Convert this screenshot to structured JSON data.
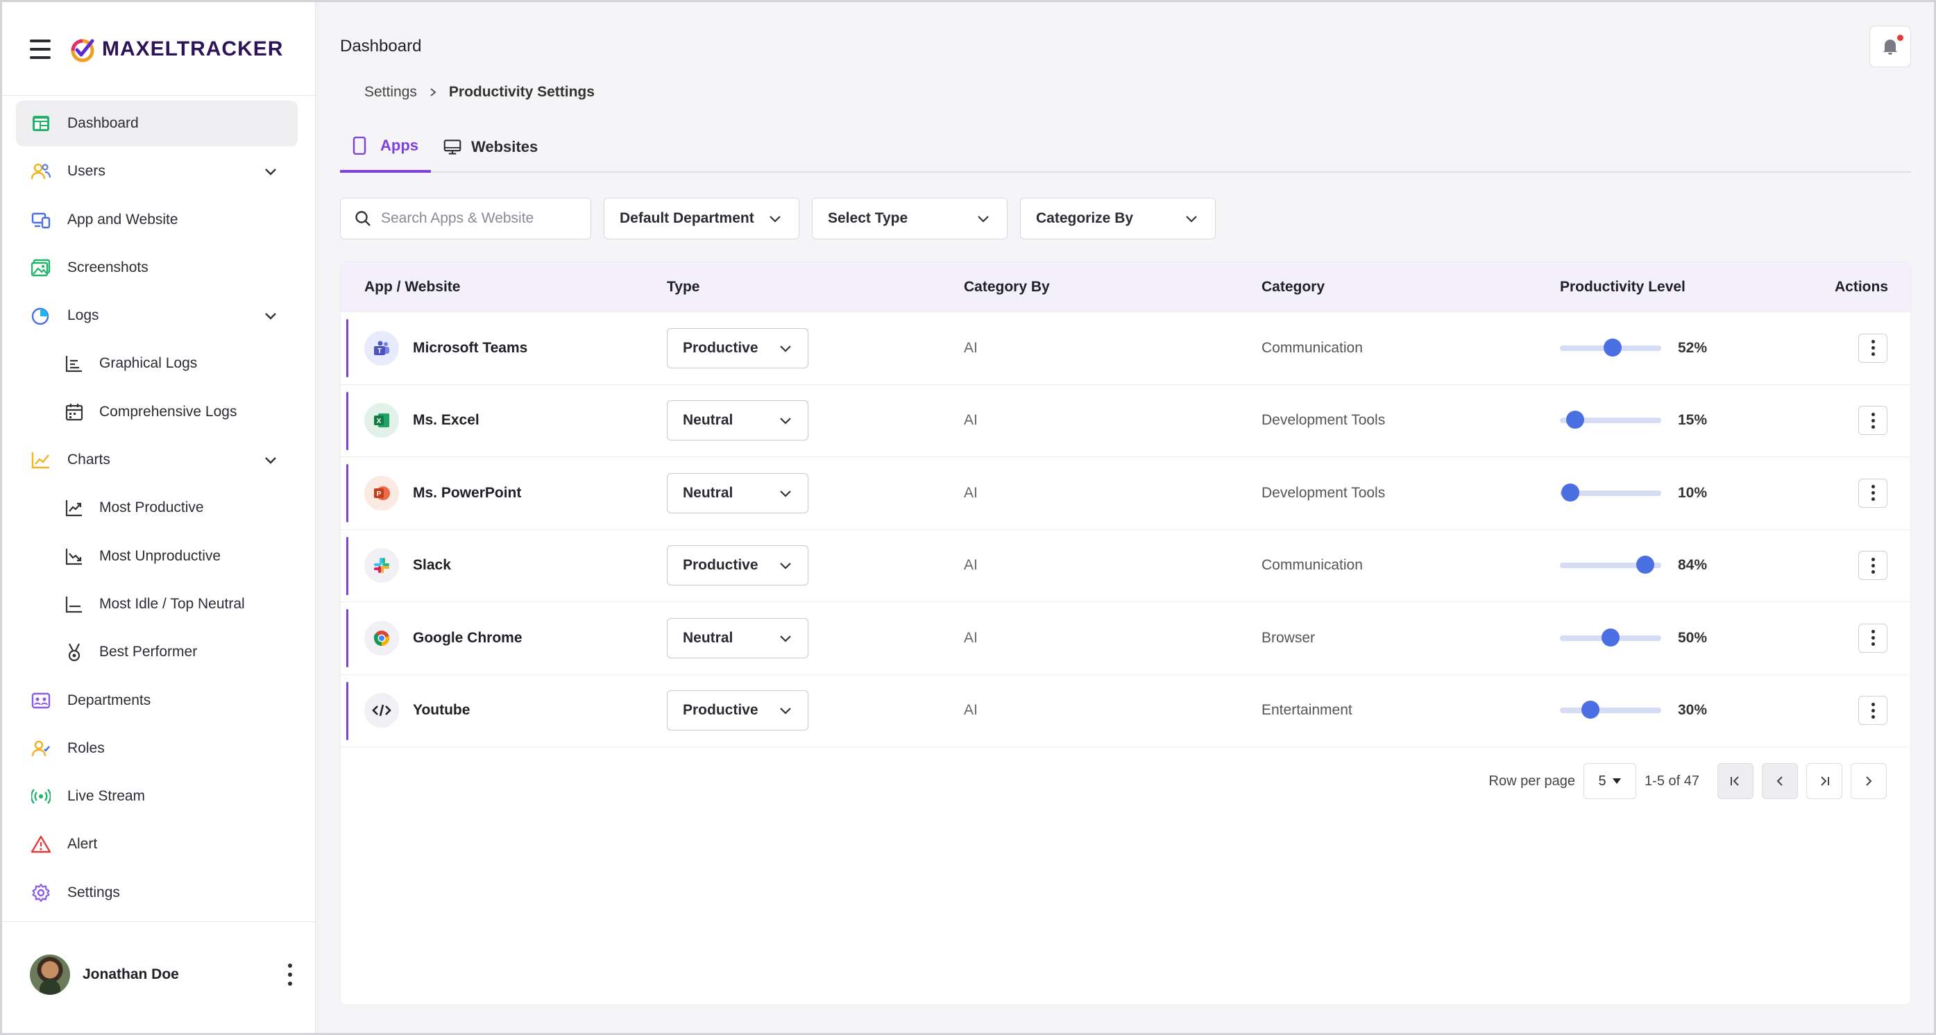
{
  "brand": {
    "name": "MAXELTRACKER"
  },
  "sidebar": {
    "items": [
      {
        "label": "Dashboard",
        "icon": "dashboard-icon",
        "active": true
      },
      {
        "label": "Users",
        "icon": "users-icon",
        "expandable": true
      },
      {
        "label": "App and Website",
        "icon": "devices-icon"
      },
      {
        "label": "Screenshots",
        "icon": "image-icon"
      },
      {
        "label": "Logs",
        "icon": "pie-chart-icon",
        "expandable": true
      },
      {
        "label": "Graphical Logs",
        "icon": "bar-chart-icon",
        "sub": true
      },
      {
        "label": "Comprehensive Logs",
        "icon": "calendar-icon",
        "sub": true
      },
      {
        "label": "Charts",
        "icon": "line-chart-icon",
        "expandable": true
      },
      {
        "label": "Most Productive",
        "icon": "trend-up-icon",
        "sub": true
      },
      {
        "label": "Most Unproductive",
        "icon": "trend-down-icon",
        "sub": true
      },
      {
        "label": "Most Idle / Top Neutral",
        "icon": "flat-chart-icon",
        "sub": true
      },
      {
        "label": "Best Performer",
        "icon": "medal-icon",
        "sub": true
      },
      {
        "label": "Departments",
        "icon": "departments-icon"
      },
      {
        "label": "Roles",
        "icon": "roles-icon"
      },
      {
        "label": "Live Stream",
        "icon": "broadcast-icon"
      },
      {
        "label": "Alert",
        "icon": "alert-icon"
      },
      {
        "label": "Settings",
        "icon": "gear-icon"
      }
    ],
    "user": {
      "name": "Jonathan Doe"
    }
  },
  "header": {
    "title": "Dashboard"
  },
  "breadcrumb": {
    "parent": "Settings",
    "current": "Productivity Settings"
  },
  "tabs": [
    {
      "label": "Apps",
      "active": true
    },
    {
      "label": "Websites",
      "active": false
    }
  ],
  "filters": {
    "search_placeholder": "Search Apps & Website",
    "department": "Default Department",
    "type": "Select Type",
    "categorize": "Categorize By"
  },
  "table": {
    "columns": [
      "App / Website",
      "Type",
      "Category By",
      "Category",
      "Productivity Level",
      "Actions"
    ],
    "rows": [
      {
        "app": "Microsoft Teams",
        "type": "Productive",
        "category_by": "AI",
        "category": "Communication",
        "level": 52,
        "level_label": "52%"
      },
      {
        "app": "Ms. Excel",
        "type": "Neutral",
        "category_by": "AI",
        "category": "Development Tools",
        "level": 15,
        "level_label": "15%"
      },
      {
        "app": "Ms. PowerPoint",
        "type": "Neutral",
        "category_by": "AI",
        "category": "Development Tools",
        "level": 10,
        "level_label": "10%"
      },
      {
        "app": "Slack",
        "type": "Productive",
        "category_by": "AI",
        "category": "Communication",
        "level": 84,
        "level_label": "84%"
      },
      {
        "app": "Google Chrome",
        "type": "Neutral",
        "category_by": "AI",
        "category": "Browser",
        "level": 50,
        "level_label": "50%"
      },
      {
        "app": "Youtube",
        "type": "Productive",
        "category_by": "AI",
        "category": "Entertainment",
        "level": 30,
        "level_label": "30%"
      }
    ]
  },
  "pagination": {
    "rows_label": "Row per page",
    "rows_value": "5",
    "range": "1-5 of 47"
  },
  "colors": {
    "accent": "#7b3fe4",
    "slider": "#4a6fe3",
    "alert": "#e53935"
  }
}
